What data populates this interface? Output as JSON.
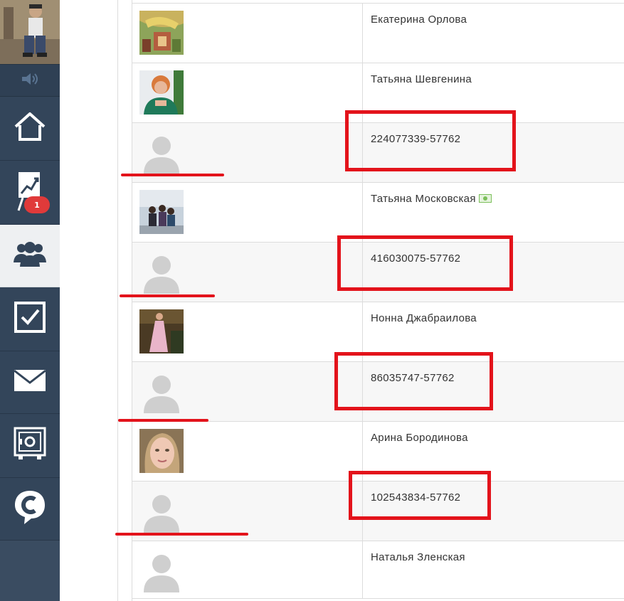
{
  "sidebar": {
    "notification_count": "1",
    "items": [
      {
        "name": "home",
        "icon": "home-icon"
      },
      {
        "name": "stats",
        "icon": "chart-easel-icon"
      },
      {
        "name": "friends",
        "icon": "users-icon",
        "active": true
      },
      {
        "name": "tasks",
        "icon": "checkbox-icon"
      },
      {
        "name": "messages",
        "icon": "envelope-icon"
      },
      {
        "name": "safe",
        "icon": "safe-icon"
      },
      {
        "name": "brand",
        "icon": "c-chat-logo-icon"
      }
    ]
  },
  "rows": [
    {
      "name": "Екатерина Орлова",
      "photo": "photo-painting",
      "alt": false
    },
    {
      "name": "Татьяна Шевгенина",
      "photo": "photo-woman-green",
      "alt": false
    },
    {
      "name": "224077339-57762",
      "photo": "placeholder",
      "alt": true
    },
    {
      "name": "Татьяна Московская",
      "photo": "photo-group",
      "alt": false,
      "money_icon": true
    },
    {
      "name": "416030075-57762",
      "photo": "placeholder",
      "alt": true
    },
    {
      "name": "Нонна Джабраилова",
      "photo": "photo-pink-dress",
      "alt": false
    },
    {
      "name": "86035747-57762",
      "photo": "placeholder",
      "alt": true
    },
    {
      "name": "Арина Бородинова",
      "photo": "photo-portrait",
      "alt": false
    },
    {
      "name": "102543834-57762",
      "photo": "placeholder",
      "alt": true
    },
    {
      "name": "Наталья Зленская",
      "photo": "placeholder",
      "alt": false
    }
  ],
  "colors": {
    "sidebar": "#33455a",
    "annotation_red": "#e3131b",
    "badge_red": "#e03a3a"
  }
}
